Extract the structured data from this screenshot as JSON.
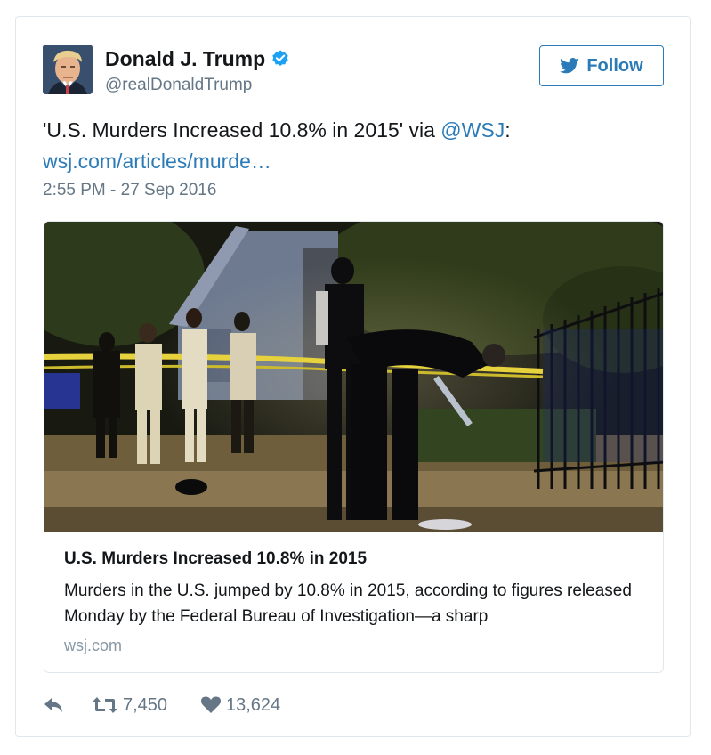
{
  "tweet": {
    "display_name": "Donald J. Trump",
    "handle": "@realDonaldTrump",
    "follow_label": "Follow",
    "text_part1": "'U.S. Murders Increased 10.8% in 2015' via ",
    "mention": "@WSJ",
    "text_part2": ":",
    "url": "wsj.com/articles/murde…",
    "timestamp": "2:55 PM - 27 Sep 2016",
    "verified_icon": "verified-badge-icon",
    "follow_icon": "twitter-bird-icon"
  },
  "card": {
    "title": "U.S. Murders Increased 10.8% in 2015",
    "description": "Murders in the U.S. jumped by 10.8% in 2015, according to figures released Monday by the Federal Bureau of Investigation—a sharp",
    "domain": "wsj.com",
    "image": "night crime scene photo with police officers and yellow tape"
  },
  "actions": {
    "reply_icon": "reply-icon",
    "retweet_icon": "retweet-icon",
    "like_icon": "heart-icon",
    "retweets": "7,450",
    "likes": "13,624"
  },
  "colors": {
    "link": "#2b7bb9",
    "text": "#14171a",
    "secondary": "#657786",
    "verified": "#1da1f2",
    "border": "#e1e8ed"
  }
}
